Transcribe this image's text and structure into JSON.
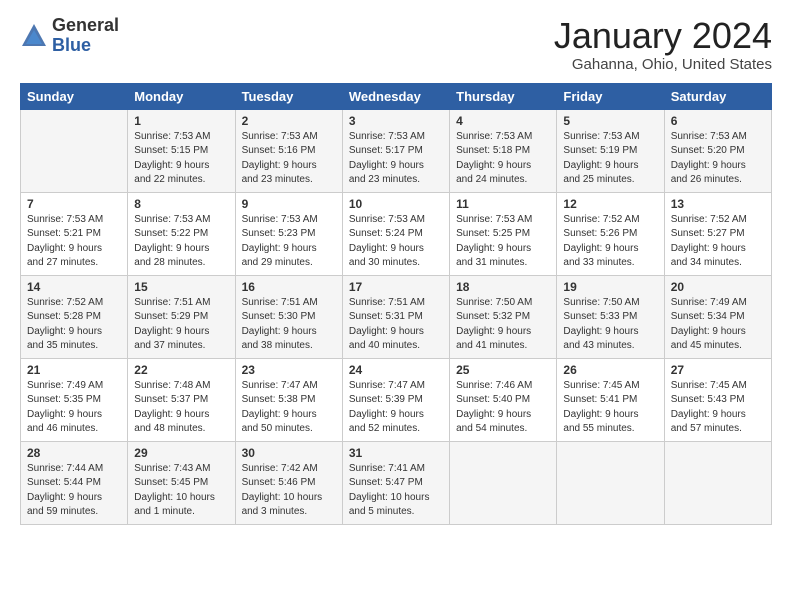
{
  "app": {
    "logo_general": "General",
    "logo_blue": "Blue"
  },
  "header": {
    "title": "January 2024",
    "location": "Gahanna, Ohio, United States"
  },
  "calendar": {
    "days_of_week": [
      "Sunday",
      "Monday",
      "Tuesday",
      "Wednesday",
      "Thursday",
      "Friday",
      "Saturday"
    ],
    "weeks": [
      [
        {
          "day": "",
          "sunrise": "",
          "sunset": "",
          "daylight": ""
        },
        {
          "day": "1",
          "sunrise": "Sunrise: 7:53 AM",
          "sunset": "Sunset: 5:15 PM",
          "daylight": "Daylight: 9 hours and 22 minutes."
        },
        {
          "day": "2",
          "sunrise": "Sunrise: 7:53 AM",
          "sunset": "Sunset: 5:16 PM",
          "daylight": "Daylight: 9 hours and 23 minutes."
        },
        {
          "day": "3",
          "sunrise": "Sunrise: 7:53 AM",
          "sunset": "Sunset: 5:17 PM",
          "daylight": "Daylight: 9 hours and 23 minutes."
        },
        {
          "day": "4",
          "sunrise": "Sunrise: 7:53 AM",
          "sunset": "Sunset: 5:18 PM",
          "daylight": "Daylight: 9 hours and 24 minutes."
        },
        {
          "day": "5",
          "sunrise": "Sunrise: 7:53 AM",
          "sunset": "Sunset: 5:19 PM",
          "daylight": "Daylight: 9 hours and 25 minutes."
        },
        {
          "day": "6",
          "sunrise": "Sunrise: 7:53 AM",
          "sunset": "Sunset: 5:20 PM",
          "daylight": "Daylight: 9 hours and 26 minutes."
        }
      ],
      [
        {
          "day": "7",
          "sunrise": "Sunrise: 7:53 AM",
          "sunset": "Sunset: 5:21 PM",
          "daylight": "Daylight: 9 hours and 27 minutes."
        },
        {
          "day": "8",
          "sunrise": "Sunrise: 7:53 AM",
          "sunset": "Sunset: 5:22 PM",
          "daylight": "Daylight: 9 hours and 28 minutes."
        },
        {
          "day": "9",
          "sunrise": "Sunrise: 7:53 AM",
          "sunset": "Sunset: 5:23 PM",
          "daylight": "Daylight: 9 hours and 29 minutes."
        },
        {
          "day": "10",
          "sunrise": "Sunrise: 7:53 AM",
          "sunset": "Sunset: 5:24 PM",
          "daylight": "Daylight: 9 hours and 30 minutes."
        },
        {
          "day": "11",
          "sunrise": "Sunrise: 7:53 AM",
          "sunset": "Sunset: 5:25 PM",
          "daylight": "Daylight: 9 hours and 31 minutes."
        },
        {
          "day": "12",
          "sunrise": "Sunrise: 7:52 AM",
          "sunset": "Sunset: 5:26 PM",
          "daylight": "Daylight: 9 hours and 33 minutes."
        },
        {
          "day": "13",
          "sunrise": "Sunrise: 7:52 AM",
          "sunset": "Sunset: 5:27 PM",
          "daylight": "Daylight: 9 hours and 34 minutes."
        }
      ],
      [
        {
          "day": "14",
          "sunrise": "Sunrise: 7:52 AM",
          "sunset": "Sunset: 5:28 PM",
          "daylight": "Daylight: 9 hours and 35 minutes."
        },
        {
          "day": "15",
          "sunrise": "Sunrise: 7:51 AM",
          "sunset": "Sunset: 5:29 PM",
          "daylight": "Daylight: 9 hours and 37 minutes."
        },
        {
          "day": "16",
          "sunrise": "Sunrise: 7:51 AM",
          "sunset": "Sunset: 5:30 PM",
          "daylight": "Daylight: 9 hours and 38 minutes."
        },
        {
          "day": "17",
          "sunrise": "Sunrise: 7:51 AM",
          "sunset": "Sunset: 5:31 PM",
          "daylight": "Daylight: 9 hours and 40 minutes."
        },
        {
          "day": "18",
          "sunrise": "Sunrise: 7:50 AM",
          "sunset": "Sunset: 5:32 PM",
          "daylight": "Daylight: 9 hours and 41 minutes."
        },
        {
          "day": "19",
          "sunrise": "Sunrise: 7:50 AM",
          "sunset": "Sunset: 5:33 PM",
          "daylight": "Daylight: 9 hours and 43 minutes."
        },
        {
          "day": "20",
          "sunrise": "Sunrise: 7:49 AM",
          "sunset": "Sunset: 5:34 PM",
          "daylight": "Daylight: 9 hours and 45 minutes."
        }
      ],
      [
        {
          "day": "21",
          "sunrise": "Sunrise: 7:49 AM",
          "sunset": "Sunset: 5:35 PM",
          "daylight": "Daylight: 9 hours and 46 minutes."
        },
        {
          "day": "22",
          "sunrise": "Sunrise: 7:48 AM",
          "sunset": "Sunset: 5:37 PM",
          "daylight": "Daylight: 9 hours and 48 minutes."
        },
        {
          "day": "23",
          "sunrise": "Sunrise: 7:47 AM",
          "sunset": "Sunset: 5:38 PM",
          "daylight": "Daylight: 9 hours and 50 minutes."
        },
        {
          "day": "24",
          "sunrise": "Sunrise: 7:47 AM",
          "sunset": "Sunset: 5:39 PM",
          "daylight": "Daylight: 9 hours and 52 minutes."
        },
        {
          "day": "25",
          "sunrise": "Sunrise: 7:46 AM",
          "sunset": "Sunset: 5:40 PM",
          "daylight": "Daylight: 9 hours and 54 minutes."
        },
        {
          "day": "26",
          "sunrise": "Sunrise: 7:45 AM",
          "sunset": "Sunset: 5:41 PM",
          "daylight": "Daylight: 9 hours and 55 minutes."
        },
        {
          "day": "27",
          "sunrise": "Sunrise: 7:45 AM",
          "sunset": "Sunset: 5:43 PM",
          "daylight": "Daylight: 9 hours and 57 minutes."
        }
      ],
      [
        {
          "day": "28",
          "sunrise": "Sunrise: 7:44 AM",
          "sunset": "Sunset: 5:44 PM",
          "daylight": "Daylight: 9 hours and 59 minutes."
        },
        {
          "day": "29",
          "sunrise": "Sunrise: 7:43 AM",
          "sunset": "Sunset: 5:45 PM",
          "daylight": "Daylight: 10 hours and 1 minute."
        },
        {
          "day": "30",
          "sunrise": "Sunrise: 7:42 AM",
          "sunset": "Sunset: 5:46 PM",
          "daylight": "Daylight: 10 hours and 3 minutes."
        },
        {
          "day": "31",
          "sunrise": "Sunrise: 7:41 AM",
          "sunset": "Sunset: 5:47 PM",
          "daylight": "Daylight: 10 hours and 5 minutes."
        },
        {
          "day": "",
          "sunrise": "",
          "sunset": "",
          "daylight": ""
        },
        {
          "day": "",
          "sunrise": "",
          "sunset": "",
          "daylight": ""
        },
        {
          "day": "",
          "sunrise": "",
          "sunset": "",
          "daylight": ""
        }
      ]
    ]
  }
}
